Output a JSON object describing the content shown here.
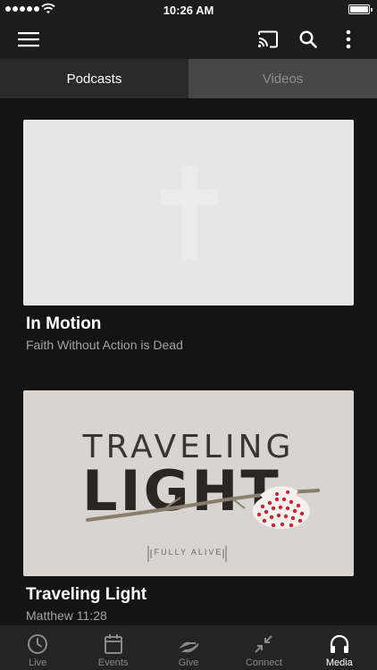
{
  "status_bar": {
    "time": "10:26 AM"
  },
  "toolbar": {
    "menu_icon": "hamburger-menu-icon",
    "cast_icon": "cast-icon",
    "search_icon": "search-icon",
    "more_icon": "vertical-ellipsis-icon"
  },
  "tabs": [
    {
      "label": "Podcasts",
      "active": true
    },
    {
      "label": "Videos",
      "active": false
    }
  ],
  "cards": [
    {
      "title": "In Motion",
      "subtitle": "Faith Without Action is Dead",
      "image": "placeholder-cross"
    },
    {
      "title": "Traveling Light",
      "subtitle": "Matthew 11:28",
      "image": "traveling-light-artwork",
      "art_line1": "TRAVELING",
      "art_line2": "LIGHT",
      "art_tag": "FULLY ALIVE"
    }
  ],
  "bottom_nav": [
    {
      "label": "Live",
      "icon": "clock-icon",
      "active": false
    },
    {
      "label": "Events",
      "icon": "calendar-icon",
      "active": false
    },
    {
      "label": "Give",
      "icon": "giving-hand-icon",
      "active": false
    },
    {
      "label": "Connect",
      "icon": "connect-arrows-icon",
      "active": false
    },
    {
      "label": "Media",
      "icon": "headphones-icon",
      "active": true
    }
  ],
  "colors": {
    "background": "#141414",
    "toolbar": "#1c1c1c",
    "tab_active": "#2a2a2a",
    "tab_inactive": "#474747",
    "subtitle": "#a3a3a3",
    "nav_background": "#242424",
    "dots": "#c4263a"
  }
}
